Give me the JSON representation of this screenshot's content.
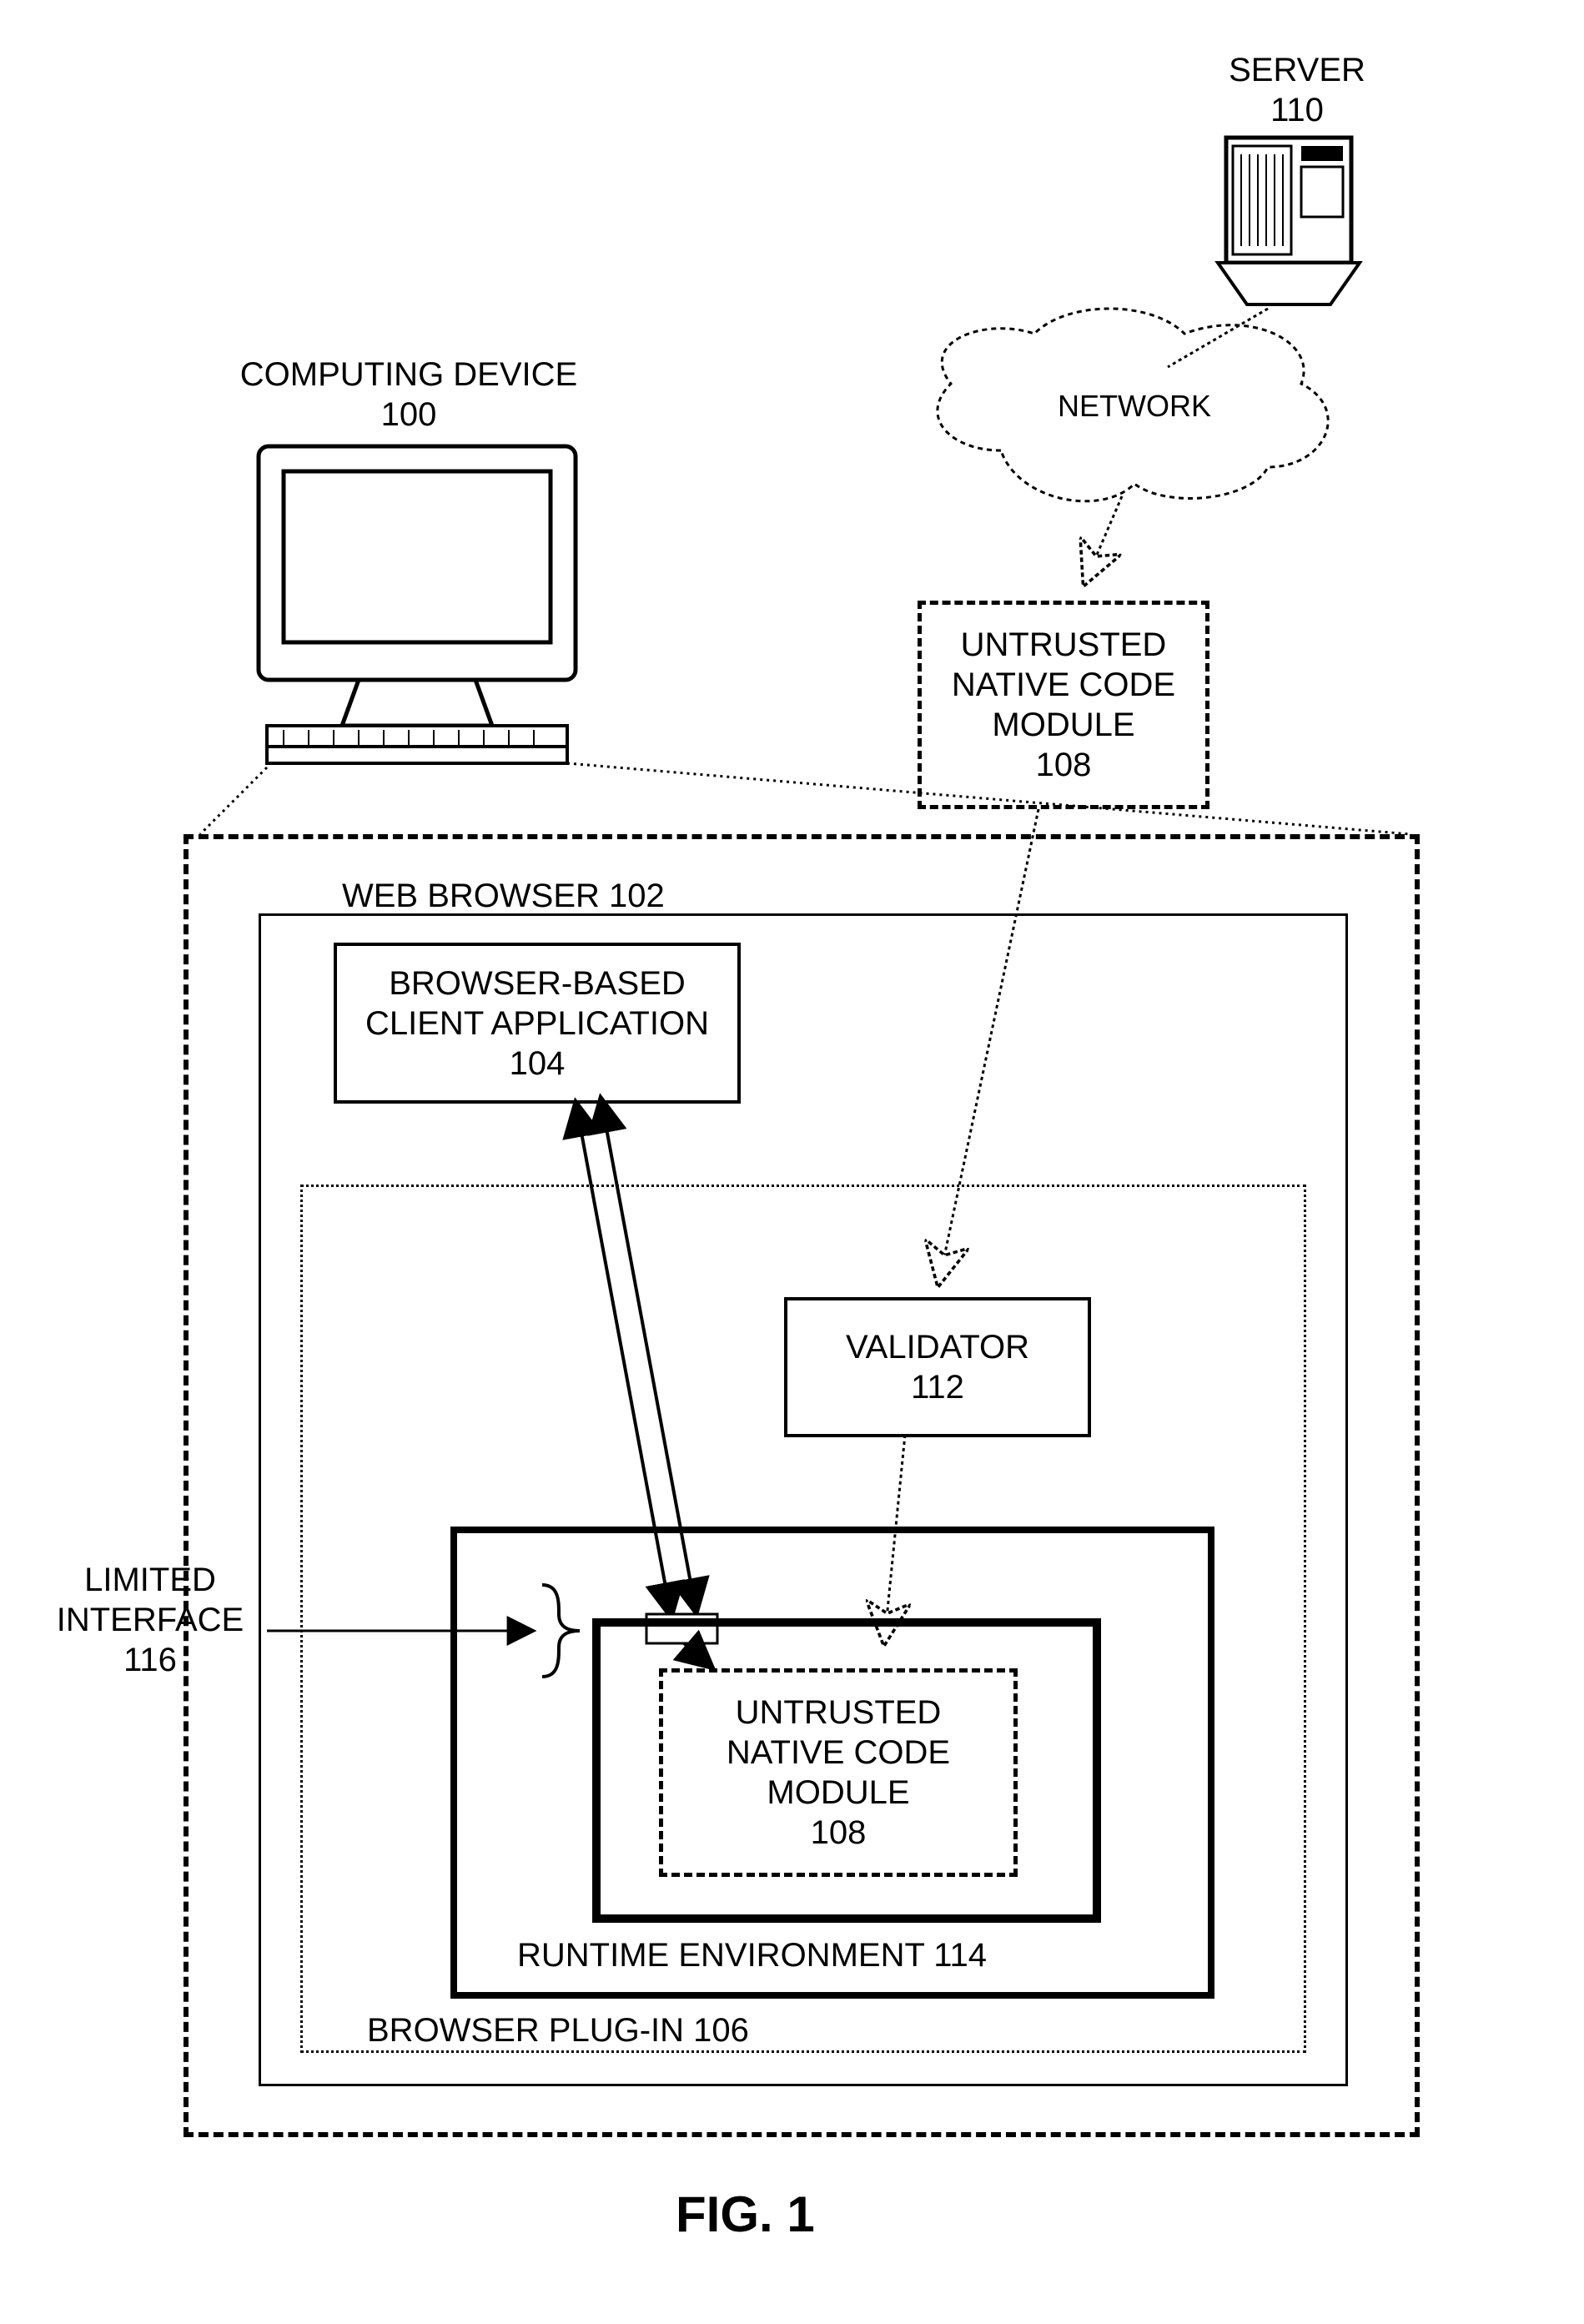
{
  "labels": {
    "computing_device": "COMPUTING DEVICE",
    "computing_device_num": "100",
    "server": "SERVER",
    "server_num": "110",
    "network": "NETWORK",
    "untrusted_native_code_module_l1": "UNTRUSTED",
    "untrusted_native_code_module_l2": "NATIVE CODE",
    "untrusted_native_code_module_l3": "MODULE",
    "untrusted_native_code_module_num": "108",
    "web_browser": "WEB BROWSER 102",
    "browser_based_client_app_l1": "BROWSER-BASED",
    "browser_based_client_app_l2": "CLIENT APPLICATION",
    "browser_based_client_app_num": "104",
    "validator": "VALIDATOR",
    "validator_num": "112",
    "runtime_env": "RUNTIME ENVIRONMENT 114",
    "browser_plugin": "BROWSER PLUG-IN 106",
    "limited_interface_l1": "LIMITED",
    "limited_interface_l2": "INTERFACE",
    "limited_interface_num": "116",
    "fig": "FIG. 1"
  }
}
